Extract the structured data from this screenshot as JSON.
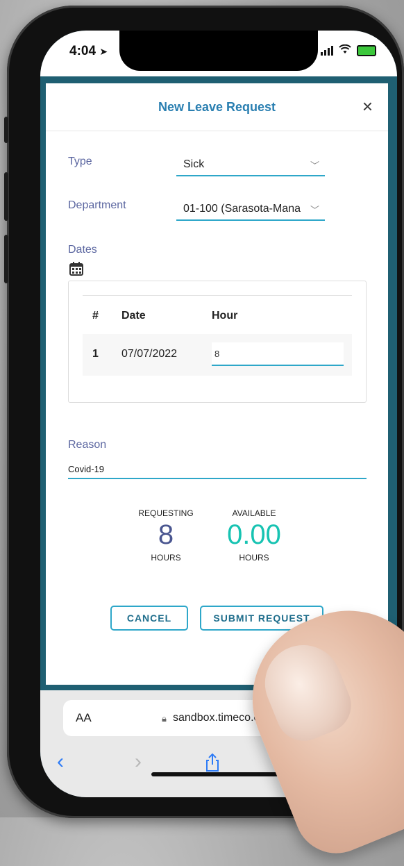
{
  "status": {
    "time": "4:04"
  },
  "modal": {
    "title": "New Leave Request",
    "close_label": "×"
  },
  "form": {
    "type_label": "Type",
    "type_value": "Sick",
    "department_label": "Department",
    "department_value": "01-100 (Sarasota-Mana",
    "dates_label": "Dates"
  },
  "table": {
    "headers": [
      "#",
      "Date",
      "Hour"
    ],
    "rows": [
      {
        "num": "1",
        "date": "07/07/2022",
        "hour": "8"
      }
    ]
  },
  "reason": {
    "label": "Reason",
    "value": "Covid-19"
  },
  "stats": {
    "requesting_label": "REQUESTING",
    "requesting_value": "8",
    "requesting_unit": "HOURS",
    "available_label": "AVAILABLE",
    "available_value": "0.00",
    "available_unit": "HOURS"
  },
  "buttons": {
    "cancel": "CANCEL",
    "submit": "SUBMIT REQUEST"
  },
  "browser": {
    "aa": "AA",
    "url": "sandbox.timeco.com"
  },
  "colors": {
    "teal": "#2ea7c9",
    "title_blue": "#2a7fb1",
    "label_purple": "#5b66a0",
    "available_green": "#17c3b2",
    "requesting_blue": "#4a5690",
    "safari_blue": "#2d7bf6"
  }
}
